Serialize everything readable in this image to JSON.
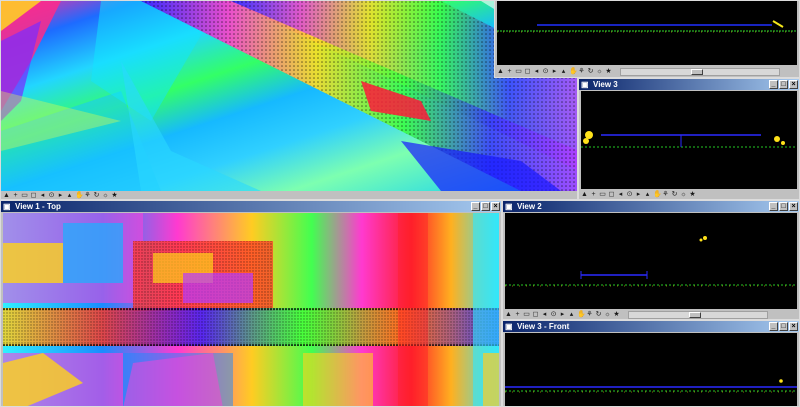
{
  "windows": {
    "main_view": {
      "title": ""
    },
    "view3_small": {
      "title": "View 3",
      "buttons": [
        "_",
        "□",
        "×"
      ]
    },
    "view1": {
      "title": "View 1 - Top",
      "buttons": [
        "_",
        "□",
        "×"
      ]
    },
    "view2": {
      "title": "View 2",
      "buttons": [
        "_",
        "□",
        "×"
      ]
    },
    "view3_front": {
      "title": "View 3 - Front",
      "buttons": [
        "_",
        "□",
        "×"
      ]
    }
  },
  "toolbar_icons": [
    "▲",
    "+",
    "▭",
    "◻",
    "◂",
    "⊙",
    "▸",
    "▴",
    "✋",
    "⚘",
    "↻",
    "☼",
    "★"
  ],
  "colors": {
    "title_active": "#0a246a",
    "viewport_bg": "#000000",
    "window_face": "#c0c0c0"
  }
}
